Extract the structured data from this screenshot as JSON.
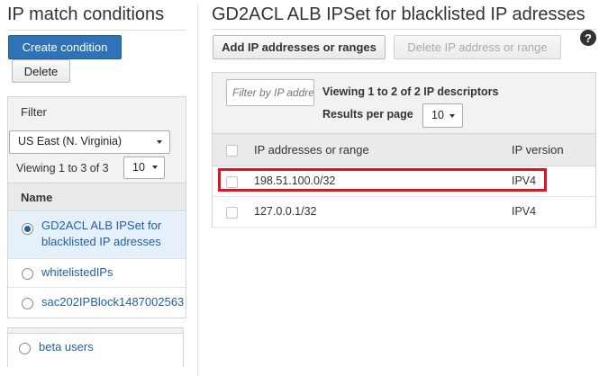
{
  "left_panel": {
    "title": "IP match conditions",
    "create_button": "Create condition",
    "delete_button": "Delete",
    "filter": {
      "label": "Filter",
      "region": "US East (N. Virginia)",
      "viewing": "Viewing 1 to 3 of 3",
      "per_page": "10"
    },
    "name_header": "Name",
    "conditions": [
      {
        "label": "GD2ACL ALB IPSet for blacklisted IP adresses",
        "selected": true
      },
      {
        "label": "whitelistedIPs",
        "selected": false
      },
      {
        "label": "sac202IPBlock1487002563",
        "selected": false
      }
    ],
    "extra_condition": {
      "label": "beta users",
      "selected": false
    }
  },
  "right_panel": {
    "title": "GD2ACL ALB IPSet for blacklisted IP adresses",
    "add_button": "Add IP addresses or ranges",
    "delete_button": "Delete IP address or range",
    "help_icon": "?",
    "filter_placeholder": "Filter by IP address",
    "viewing": "Viewing 1 to 2 of 2 IP descriptors",
    "results_per_page_label": "Results per page",
    "per_page": "10",
    "columns": [
      "IP addresses or range",
      "IP version"
    ],
    "rows": [
      {
        "ip": "198.51.100.0/32",
        "version": "IPV4",
        "highlighted": true
      },
      {
        "ip": "127.0.0.1/32",
        "version": "IPV4",
        "highlighted": false
      }
    ]
  },
  "colors": {
    "primary_button": "#2e73b8",
    "link": "#1f5fa8",
    "highlight_border": "#e0141e",
    "selected_row": "#e6f0fa"
  }
}
